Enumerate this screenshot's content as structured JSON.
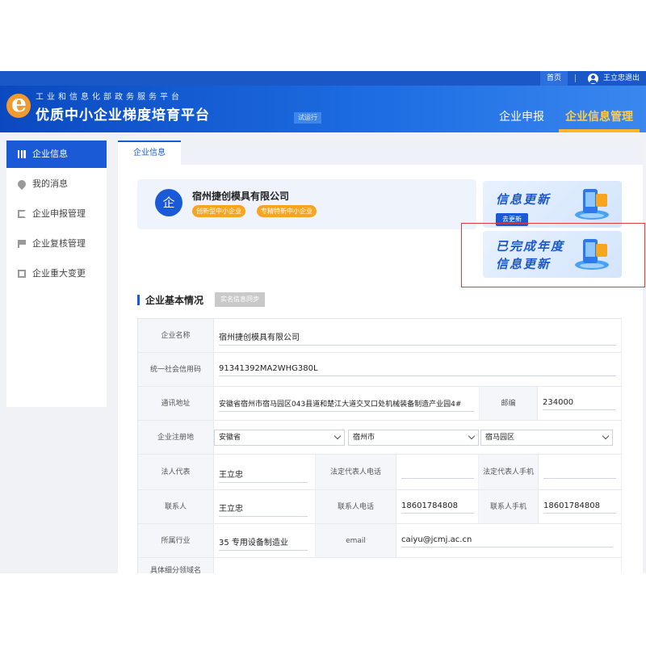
{
  "topbar": {
    "home": "首页",
    "user_logout": "王立忠退出"
  },
  "header": {
    "subtitle": "工业和信息化部政务服务平台",
    "title": "优质中小企业梯度培育平台",
    "trial": "试运行",
    "nav": [
      {
        "label": "企业申报"
      },
      {
        "label": "企业信息管理"
      }
    ],
    "colors": {
      "primary": "#1a5ad6",
      "accent": "#ffb52e"
    }
  },
  "sidebar": {
    "items": [
      {
        "label": "企业信息",
        "icon": "bar-chart-icon"
      },
      {
        "label": "我的消息",
        "icon": "location-pin-icon"
      },
      {
        "label": "企业申报管理",
        "icon": "edit-icon"
      },
      {
        "label": "企业复核管理",
        "icon": "flag-icon"
      },
      {
        "label": "企业重大变更",
        "icon": "document-icon"
      }
    ]
  },
  "main": {
    "tab": "企业信息",
    "company": {
      "icon_char": "企",
      "name": "宿州捷创模具有限公司",
      "badges": [
        "创新型中小企业",
        "专精特新中小企业"
      ]
    },
    "promo_update": {
      "title": "信息更新",
      "button": "去更新"
    },
    "promo_done": {
      "line1": "已完成年度",
      "line2": "信息更新"
    },
    "section_title": "企业基本情况",
    "sync_button": "实名信息同步",
    "form": {
      "company_name": {
        "label": "企业名称",
        "value": "宿州捷创模具有限公司"
      },
      "credit_code": {
        "label": "统一社会信用码",
        "value": "91341392MA2WHG380L"
      },
      "address": {
        "label": "通讯地址",
        "value": "安徽省宿州市宿马园区043县道和楚江大道交叉口处机械装备制造产业园4#"
      },
      "postcode": {
        "label": "邮编",
        "value": "234000"
      },
      "region": {
        "label": "企业注册地",
        "province": "安徽省",
        "city": "宿州市",
        "district": "宿马园区"
      },
      "legal_rep": {
        "label": "法人代表",
        "value": "王立忠"
      },
      "legal_phone": {
        "label": "法定代表人电话",
        "value": ""
      },
      "legal_mobile": {
        "label": "法定代表人手机",
        "value": ""
      },
      "contact": {
        "label": "联系人",
        "value": "王立忠"
      },
      "contact_phone": {
        "label": "联系人电话",
        "value": "18601784808"
      },
      "contact_mobile": {
        "label": "联系人手机",
        "value": "18601784808"
      },
      "industry": {
        "label": "所属行业",
        "value": "35 专用设备制造业"
      },
      "email": {
        "label": "email",
        "value": "caiyu@jcmj.ac.cn"
      },
      "segment": {
        "label": "具体细分领域名"
      }
    }
  }
}
